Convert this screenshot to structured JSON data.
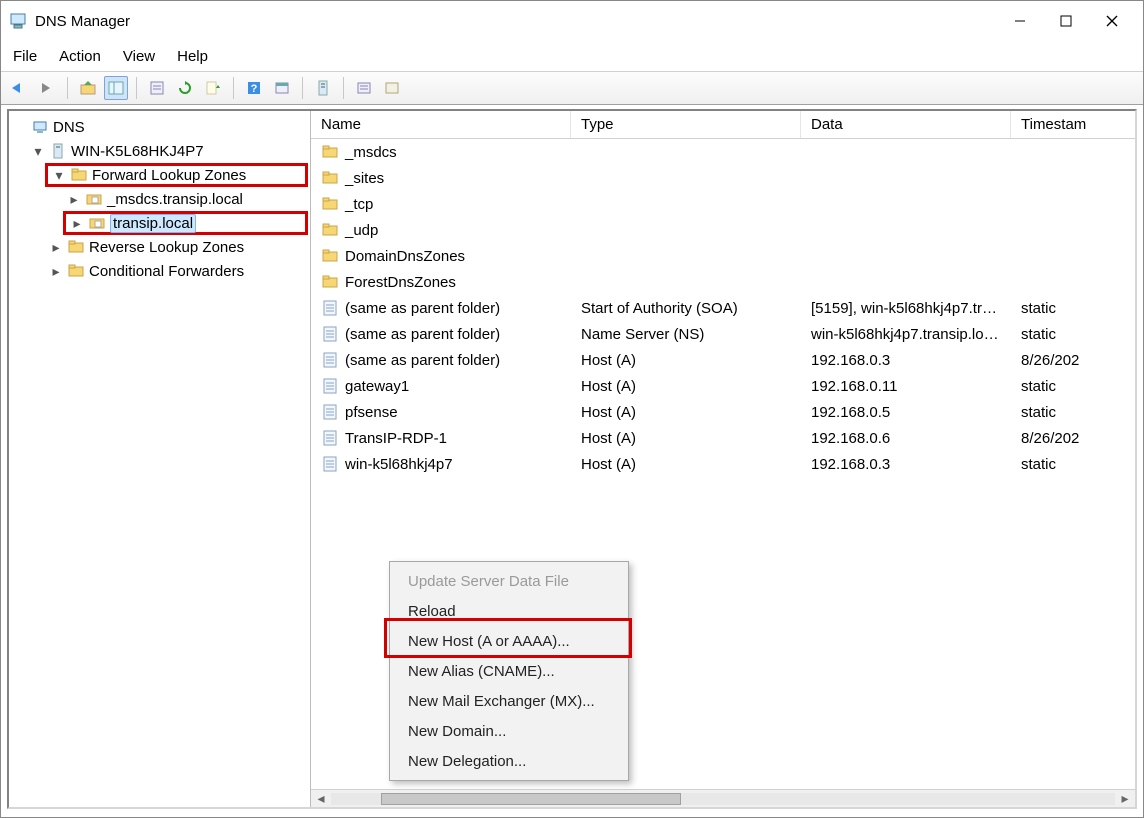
{
  "window": {
    "title": "DNS Manager"
  },
  "menu": {
    "file": "File",
    "action": "Action",
    "view": "View",
    "help": "Help"
  },
  "tree": {
    "root": "DNS",
    "server": "WIN-K5L68HKJ4P7",
    "flz": "Forward Lookup Zones",
    "msdcs": "_msdcs.transip.local",
    "zone": "transip.local",
    "rlz": "Reverse Lookup Zones",
    "cf": "Conditional Forwarders"
  },
  "columns": {
    "name": "Name",
    "type": "Type",
    "data": "Data",
    "ts": "Timestam"
  },
  "records": [
    {
      "name": "_msdcs",
      "type": "",
      "data": "",
      "ts": "",
      "icon": "folder"
    },
    {
      "name": "_sites",
      "type": "",
      "data": "",
      "ts": "",
      "icon": "folder"
    },
    {
      "name": "_tcp",
      "type": "",
      "data": "",
      "ts": "",
      "icon": "folder"
    },
    {
      "name": "_udp",
      "type": "",
      "data": "",
      "ts": "",
      "icon": "folder"
    },
    {
      "name": "DomainDnsZones",
      "type": "",
      "data": "",
      "ts": "",
      "icon": "folder"
    },
    {
      "name": "ForestDnsZones",
      "type": "",
      "data": "",
      "ts": "",
      "icon": "folder"
    },
    {
      "name": "(same as parent folder)",
      "type": "Start of Authority (SOA)",
      "data": "[5159], win-k5l68hkj4p7.tra...",
      "ts": "static",
      "icon": "record"
    },
    {
      "name": "(same as parent folder)",
      "type": "Name Server (NS)",
      "data": "win-k5l68hkj4p7.transip.loc...",
      "ts": "static",
      "icon": "record"
    },
    {
      "name": "(same as parent folder)",
      "type": "Host (A)",
      "data": "192.168.0.3",
      "ts": "8/26/202",
      "icon": "record"
    },
    {
      "name": "gateway1",
      "type": "Host (A)",
      "data": "192.168.0.11",
      "ts": "static",
      "icon": "record"
    },
    {
      "name": "pfsense",
      "type": "Host (A)",
      "data": "192.168.0.5",
      "ts": "static",
      "icon": "record"
    },
    {
      "name": "TransIP-RDP-1",
      "type": "Host (A)",
      "data": "192.168.0.6",
      "ts": "8/26/202",
      "icon": "record"
    },
    {
      "name": "win-k5l68hkj4p7",
      "type": "Host (A)",
      "data": "192.168.0.3",
      "ts": "static",
      "icon": "record"
    }
  ],
  "context_menu": {
    "update": "Update Server Data File",
    "reload": "Reload",
    "new_host": "New Host (A or AAAA)...",
    "new_alias": "New Alias (CNAME)...",
    "new_mx": "New Mail Exchanger (MX)...",
    "new_domain": "New Domain...",
    "new_delegation": "New Delegation..."
  }
}
